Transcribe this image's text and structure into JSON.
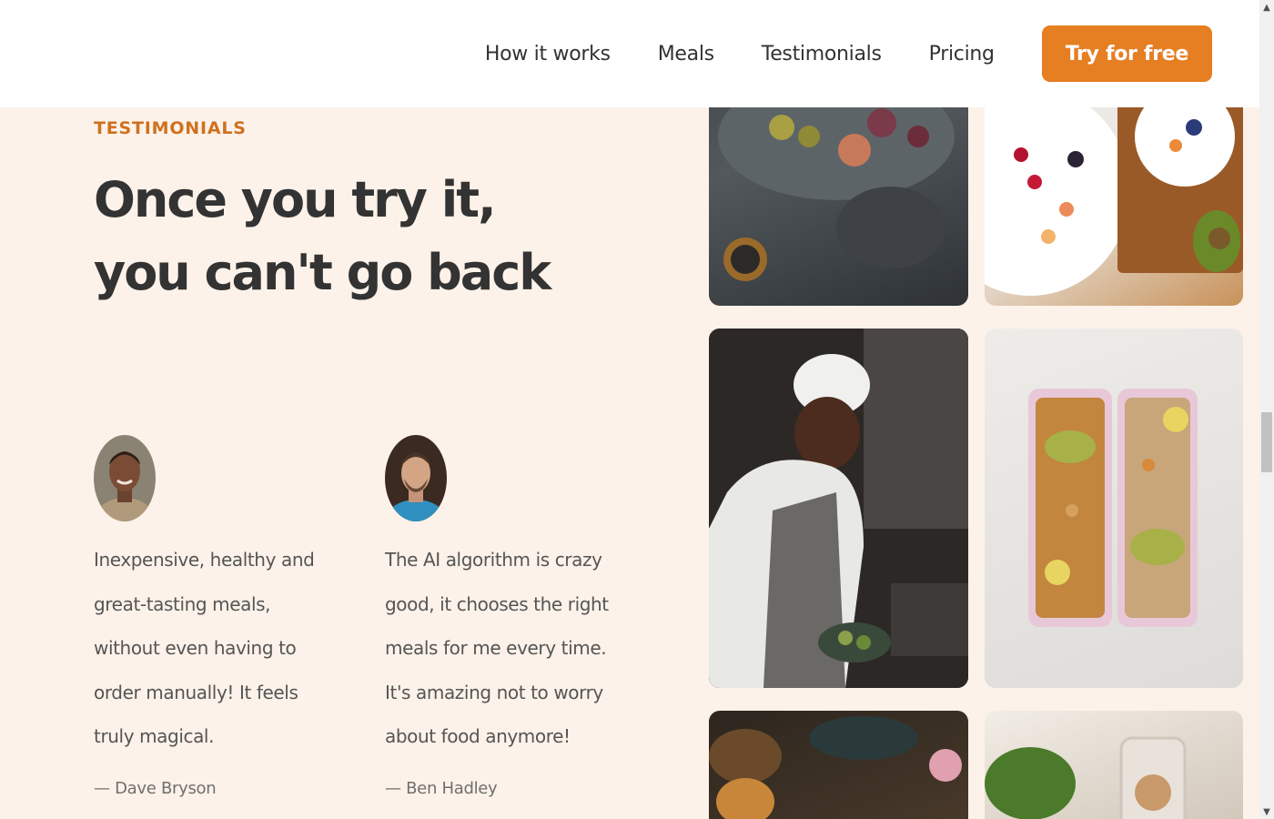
{
  "nav": {
    "links": [
      "How it works",
      "Meals",
      "Testimonials",
      "Pricing"
    ],
    "cta": "Try for free"
  },
  "section": {
    "subheading": "TESTIMONIALS",
    "heading": "Once you try it, you can't go back"
  },
  "testimonials": [
    {
      "quote": "Inexpensive, healthy and great-tasting meals, without even having to order manually! It feels truly magical.",
      "author": "— Dave Bryson"
    },
    {
      "quote": "The AI algorithm is crazy good, it chooses the right meals for me every time. It's amazing not to worry about food anymore!",
      "author": "— Ben Hadley"
    }
  ],
  "colors": {
    "accent": "#e67e22",
    "subheading": "#cf711f",
    "background": "#fdf2e9",
    "text": "#333333"
  }
}
